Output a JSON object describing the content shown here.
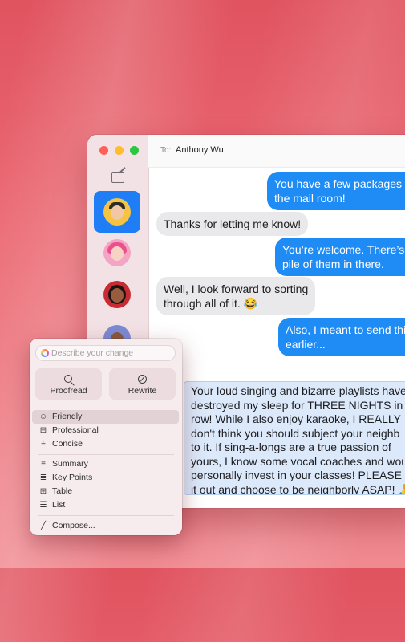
{
  "window": {
    "to_label": "To:",
    "recipient": "Anthony Wu"
  },
  "sidebar": {
    "contacts": [
      {
        "name": "contact-1",
        "active": true
      },
      {
        "name": "contact-2",
        "active": false
      },
      {
        "name": "contact-3",
        "active": false
      },
      {
        "name": "contact-4",
        "active": false
      }
    ]
  },
  "messages": [
    {
      "dir": "out",
      "text": "You have a few packages s\nthe mail room!"
    },
    {
      "dir": "in",
      "text": "Thanks for letting me know!"
    },
    {
      "dir": "out",
      "text": "You’re welcome. There’s\npile of them in there."
    },
    {
      "dir": "in",
      "text": "Well, I look forward to sorting\nthrough all of it. 😂"
    },
    {
      "dir": "out",
      "text": "Also, I meant to send thi\nearlier..."
    }
  ],
  "compose_field": {
    "lines": [
      "Your loud singing and bizarre playlists have",
      "destroyed my sleep for THREE NIGHTS in a",
      "row! While I also enjoy karaoke, I REALLY",
      "don't think you should subject your neighb",
      "to it. If sing-a-longs are a true passion of",
      "yours, I know some vocal coaches and wou",
      "personally invest in your classes! PLEASE c",
      "it out and choose to be neighborly ASAP! 🙏"
    ]
  },
  "writing_tools": {
    "describe_placeholder": "Describe your change",
    "proofread_label": "Proofread",
    "rewrite_label": "Rewrite",
    "tone_items": [
      {
        "label": "Friendly",
        "icon": "smiley-icon",
        "selected": true
      },
      {
        "label": "Professional",
        "icon": "briefcase-icon",
        "selected": false
      },
      {
        "label": "Concise",
        "icon": "concise-icon",
        "selected": false
      }
    ],
    "format_items": [
      {
        "label": "Summary",
        "icon": "summary-icon"
      },
      {
        "label": "Key Points",
        "icon": "key-points-icon"
      },
      {
        "label": "Table",
        "icon": "table-icon"
      },
      {
        "label": "List",
        "icon": "list-icon"
      }
    ],
    "compose_label": "Compose..."
  },
  "colors": {
    "accent": "#1f8cf5",
    "selection": "#1f7ef5"
  }
}
